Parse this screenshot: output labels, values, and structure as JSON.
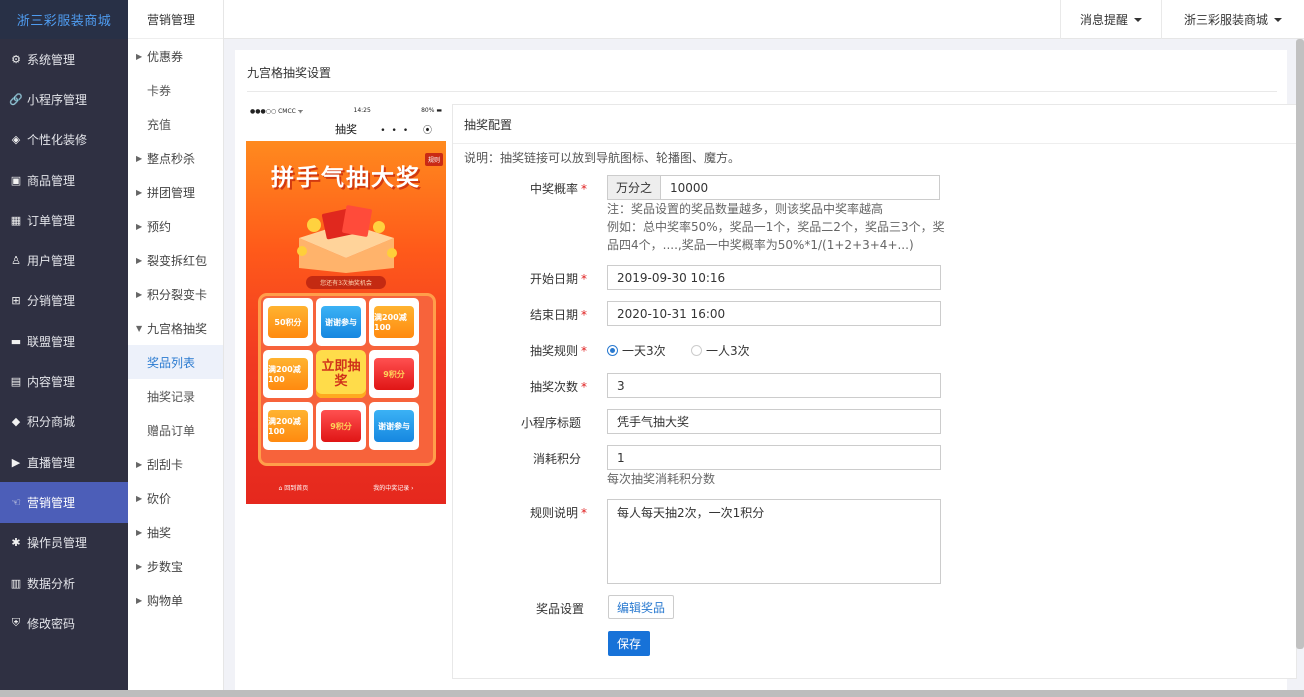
{
  "brand": "浙三彩服装商城",
  "sidebar": {
    "items": [
      {
        "label": "系统管理",
        "icon": "gear-icon",
        "glyph": "⚙"
      },
      {
        "label": "小程序管理",
        "icon": "link-icon",
        "glyph": "🔗"
      },
      {
        "label": "个性化装修",
        "icon": "diamond-icon",
        "glyph": "◈"
      },
      {
        "label": "商品管理",
        "icon": "box-icon",
        "glyph": "▣"
      },
      {
        "label": "订单管理",
        "icon": "calendar-icon",
        "glyph": "▦"
      },
      {
        "label": "用户管理",
        "icon": "user-icon",
        "glyph": "♙"
      },
      {
        "label": "分销管理",
        "icon": "sitemap-icon",
        "glyph": "⊞"
      },
      {
        "label": "联盟管理",
        "icon": "card-icon",
        "glyph": "▬"
      },
      {
        "label": "内容管理",
        "icon": "window-icon",
        "glyph": "▤"
      },
      {
        "label": "积分商城",
        "icon": "cube-icon",
        "glyph": "◆"
      },
      {
        "label": "直播管理",
        "icon": "play-icon",
        "glyph": "▶"
      },
      {
        "label": "营销管理",
        "icon": "megaphone-icon",
        "glyph": "☜"
      },
      {
        "label": "操作员管理",
        "icon": "cog-icon",
        "glyph": "✱"
      },
      {
        "label": "数据分析",
        "icon": "bar-chart-icon",
        "glyph": "▥"
      },
      {
        "label": "修改密码",
        "icon": "shield-icon",
        "glyph": "⛨"
      }
    ],
    "active_index": 11
  },
  "submenu": {
    "title": "营销管理",
    "items": [
      {
        "label": "优惠券",
        "arrow": "▶",
        "child": false
      },
      {
        "label": "卡券",
        "arrow": "",
        "child": true
      },
      {
        "label": "充值",
        "arrow": "",
        "child": true
      },
      {
        "label": "整点秒杀",
        "arrow": "▶",
        "child": false
      },
      {
        "label": "拼团管理",
        "arrow": "▶",
        "child": false
      },
      {
        "label": "预约",
        "arrow": "▶",
        "child": false
      },
      {
        "label": "裂变拆红包",
        "arrow": "▶",
        "child": false
      },
      {
        "label": "积分裂变卡",
        "arrow": "▶",
        "child": false
      },
      {
        "label": "九宫格抽奖",
        "arrow": "▼",
        "child": false
      },
      {
        "label": "奖品列表",
        "arrow": "",
        "child": true,
        "current": true
      },
      {
        "label": "抽奖记录",
        "arrow": "",
        "child": true
      },
      {
        "label": "赠品订单",
        "arrow": "",
        "child": true
      },
      {
        "label": "刮刮卡",
        "arrow": "▶",
        "child": false
      },
      {
        "label": "砍价",
        "arrow": "▶",
        "child": false
      },
      {
        "label": "抽奖",
        "arrow": "▶",
        "child": false
      },
      {
        "label": "步数宝",
        "arrow": "▶",
        "child": false
      },
      {
        "label": "购物单",
        "arrow": "▶",
        "child": false
      }
    ]
  },
  "header": {
    "notifications": "消息提醒",
    "store": "浙三彩服装商城"
  },
  "panel": {
    "title": "九宫格抽奖设置"
  },
  "phone": {
    "carrier": "●●●○○ CMCC ᯤ",
    "time": "14:25",
    "battery": "80% ▬",
    "title": "抽奖",
    "menu_icons": "••• ⦿",
    "tag": "规则",
    "promo_title": "拼手气抽大奖",
    "chance": "您还有3次抽奖机会",
    "cells": [
      "50积分",
      "谢谢参与",
      "满200减100",
      "9积分",
      "谢谢参与",
      "9积分",
      "满200减100",
      "满200减100"
    ],
    "center": "立即抽奖",
    "foot_left": "⌂ 回到首页",
    "foot_right": "我的中奖记录 ›"
  },
  "form": {
    "card_title": "抽奖配置",
    "note": "说明：抽奖链接可以放到导航图标、轮播图、魔方。",
    "probability": {
      "label": "中奖概率",
      "addon": "万分之",
      "value": "10000",
      "help1": "注：奖品设置的奖品数量越多，则该奖品中奖率越高",
      "help2": "例如：总中奖率50%，奖品一1个，奖品二2个，奖品三3个，奖",
      "help3": "品四4个，....,奖品一中奖概率为50%*1/(1+2+3+4+...)"
    },
    "start": {
      "label": "开始日期",
      "value": "2019-09-30 10:16"
    },
    "end": {
      "label": "结束日期",
      "value": "2020-10-31 16:00"
    },
    "rule": {
      "label": "抽奖规则",
      "opt1": "一天3次",
      "opt2": "一人3次",
      "selected": 1
    },
    "times": {
      "label": "抽奖次数",
      "value": "3"
    },
    "mp_title": {
      "label": "小程序标题",
      "value": "凭手气抽大奖"
    },
    "points": {
      "label": "消耗积分",
      "value": "1",
      "help": "每次抽奖消耗积分数"
    },
    "desc": {
      "label": "规则说明",
      "value": "每人每天抽2次，一次1积分"
    },
    "prize": {
      "label": "奖品设置",
      "button": "编辑奖品"
    },
    "save": "保存"
  },
  "colors": {
    "sidebar_bg": "#2f3042",
    "active": "#4c5eb8",
    "primary": "#1772d8",
    "required": "#e02020"
  }
}
